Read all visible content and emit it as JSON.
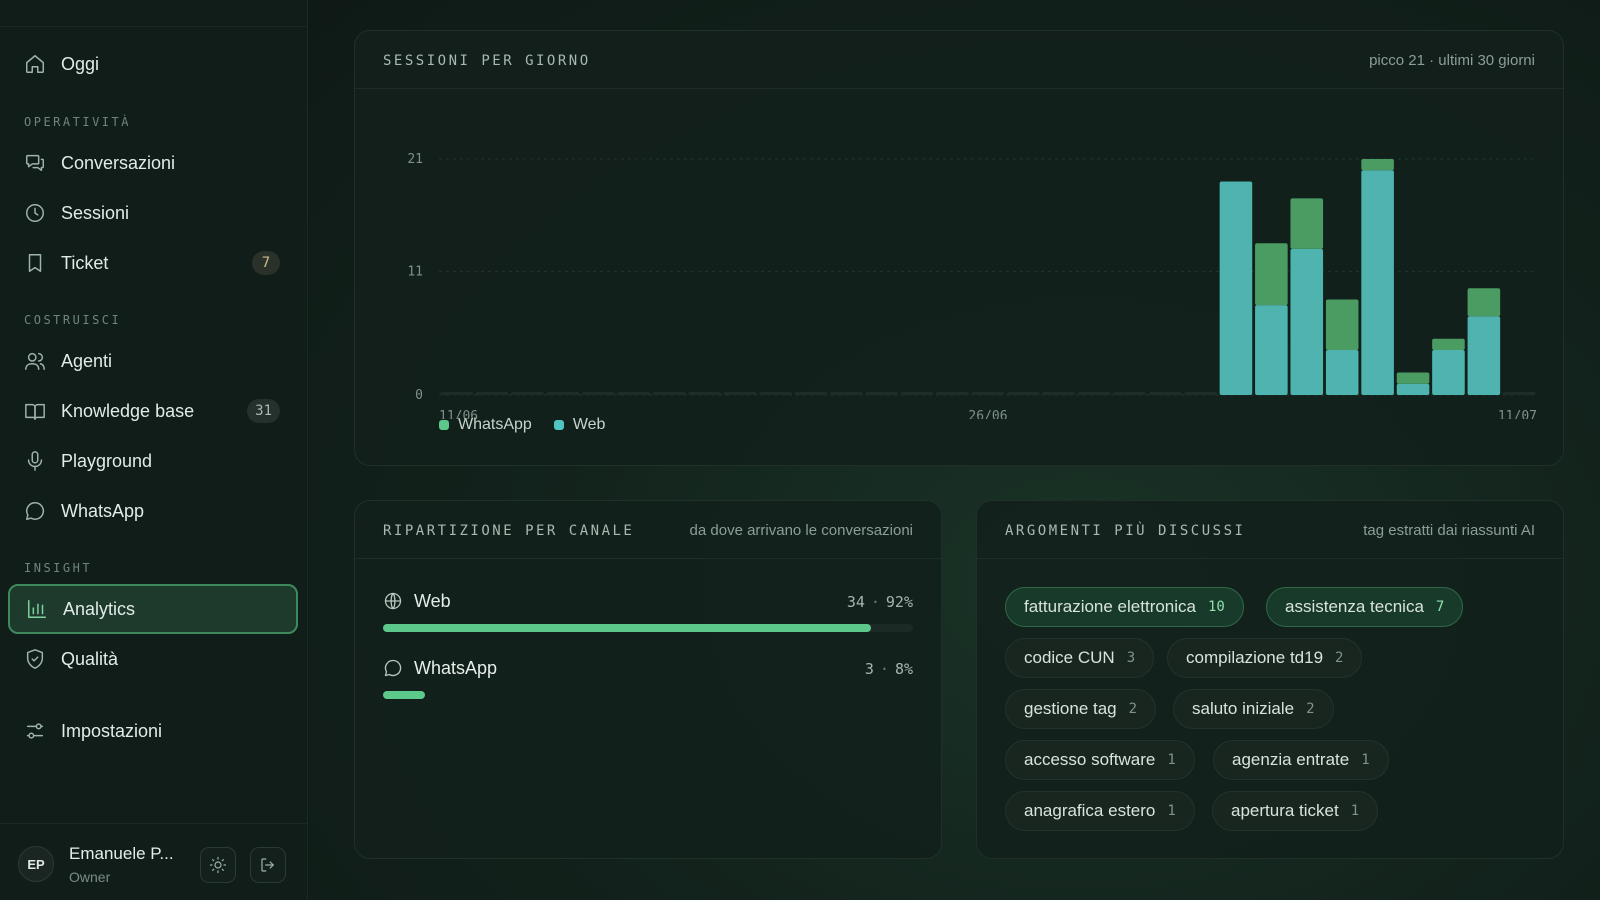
{
  "sidebar": {
    "today": "Oggi",
    "sections": {
      "operativita": "OPERATIVITÀ",
      "costruisci": "COSTRUISCI",
      "insight": "INSIGHT"
    },
    "items": {
      "conversazioni": "Conversazioni",
      "sessioni": "Sessioni",
      "ticket": "Ticket",
      "ticket_badge": "7",
      "agenti": "Agenti",
      "knowledge": "Knowledge base",
      "knowledge_badge": "31",
      "playground": "Playground",
      "whatsapp": "WhatsApp",
      "analytics": "Analytics",
      "qualita": "Qualità",
      "impostazioni": "Impostazioni"
    },
    "user": {
      "initials": "EP",
      "name": "Emanuele P...",
      "role": "Owner"
    }
  },
  "sessions_card": {
    "title": "SESSIONI PER GIORNO",
    "subtitle": "picco 21 · ultimi 30 giorni"
  },
  "chart_data": {
    "type": "bar",
    "stacked": true,
    "title": "SESSIONI PER GIORNO",
    "xlabel": "",
    "ylabel": "",
    "ylim": [
      0,
      21
    ],
    "yticks": [
      "21",
      "11",
      "0"
    ],
    "x_tick_labels": [
      "11/06",
      "26/06",
      "11/07"
    ],
    "x_tick_index": [
      0,
      15,
      30
    ],
    "categories": [
      "11/06",
      "12/06",
      "13/06",
      "14/06",
      "15/06",
      "16/06",
      "17/06",
      "18/06",
      "19/06",
      "20/06",
      "21/06",
      "22/06",
      "23/06",
      "24/06",
      "25/06",
      "26/06",
      "27/06",
      "28/06",
      "29/06",
      "30/06",
      "01/07",
      "02/07",
      "03/07",
      "04/07",
      "05/07",
      "06/07",
      "07/07",
      "08/07",
      "09/07",
      "10/07",
      "11/07"
    ],
    "series": [
      {
        "name": "Web",
        "color": "#4fb3b0",
        "values": [
          0,
          0,
          0,
          0,
          0,
          0,
          0,
          0,
          0,
          0,
          0,
          0,
          0,
          0,
          0,
          0,
          0,
          0,
          0,
          0,
          0,
          0,
          19,
          8,
          13,
          4,
          20,
          1,
          4,
          7,
          0
        ]
      },
      {
        "name": "WhatsApp",
        "color": "#4a9c63",
        "values": [
          0,
          0,
          0,
          0,
          0,
          0,
          0,
          0,
          0,
          0,
          0,
          0,
          0,
          0,
          0,
          0,
          0,
          0,
          0,
          0,
          0,
          0,
          0,
          5.5,
          4.5,
          4.5,
          1,
          1,
          1,
          2.5,
          0
        ]
      }
    ],
    "legend": [
      "WhatsApp",
      "Web"
    ],
    "legend_colors": [
      "#5cc98a",
      "#4fc4c0"
    ],
    "legend_position": "bottom-left",
    "grid": true
  },
  "channel_card": {
    "title": "RIPARTIZIONE PER CANALE",
    "subtitle": "da dove arrivano le conversazioni",
    "rows": [
      {
        "name": "Web",
        "count": "34",
        "sep": "·",
        "pct": "92%",
        "fraction": 0.92
      },
      {
        "name": "WhatsApp",
        "count": "3",
        "sep": "·",
        "pct": "8%",
        "fraction": 0.08
      }
    ]
  },
  "topics_card": {
    "title": "ARGOMENTI PIÙ DISCUSSI",
    "subtitle": "tag estratti dai riassunti AI",
    "tags": [
      {
        "name": "fatturazione elettronica",
        "count": "10"
      },
      {
        "name": "assistenza tecnica",
        "count": "7"
      },
      {
        "name": "codice CUN",
        "count": "3"
      },
      {
        "name": "compilazione td19",
        "count": "2"
      },
      {
        "name": "gestione tag",
        "count": "2"
      },
      {
        "name": "saluto iniziale",
        "count": "2"
      },
      {
        "name": "accesso software",
        "count": "1"
      },
      {
        "name": "agenzia entrate",
        "count": "1"
      },
      {
        "name": "anagrafica estero",
        "count": "1"
      },
      {
        "name": "apertura ticket",
        "count": "1"
      }
    ]
  },
  "colors": {
    "accent": "#5cc98a",
    "web": "#4fb3b0",
    "whatsapp": "#4a9c63",
    "badge_ticket": "#cdbf8a"
  }
}
